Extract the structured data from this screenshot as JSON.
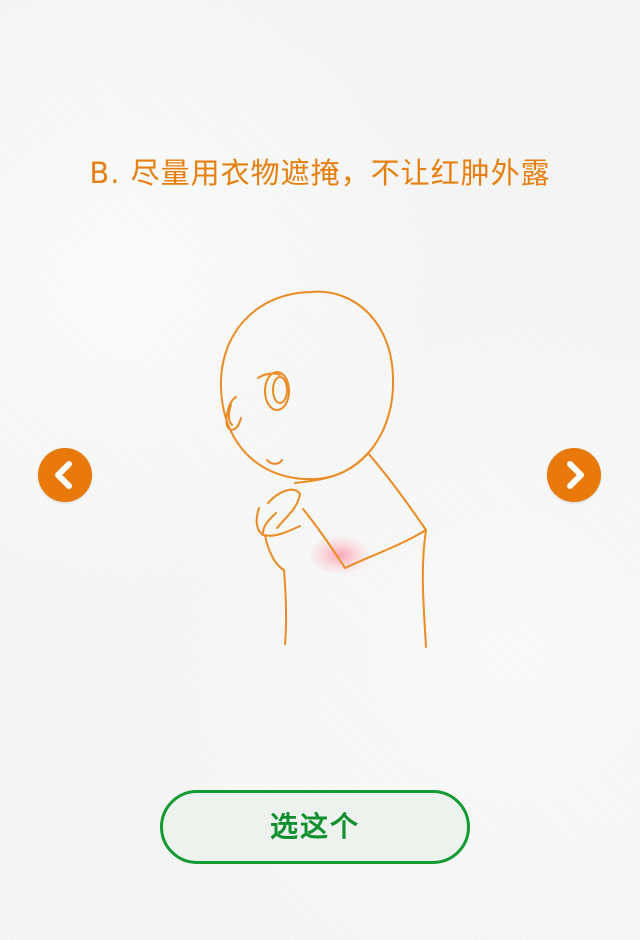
{
  "question": {
    "text": "B. 尽量用衣物遮掩，不让红肿外露"
  },
  "navigation": {
    "prev_icon": "chevron-left-icon",
    "next_icon": "chevron-right-icon"
  },
  "illustration": {
    "subject": "cartoon figure covering neck redness with a collar"
  },
  "actions": {
    "choose_label": "选这个"
  },
  "colors": {
    "accent": "#e67f0d",
    "button_border": "#149a33",
    "button_text": "#0f8f2e"
  }
}
